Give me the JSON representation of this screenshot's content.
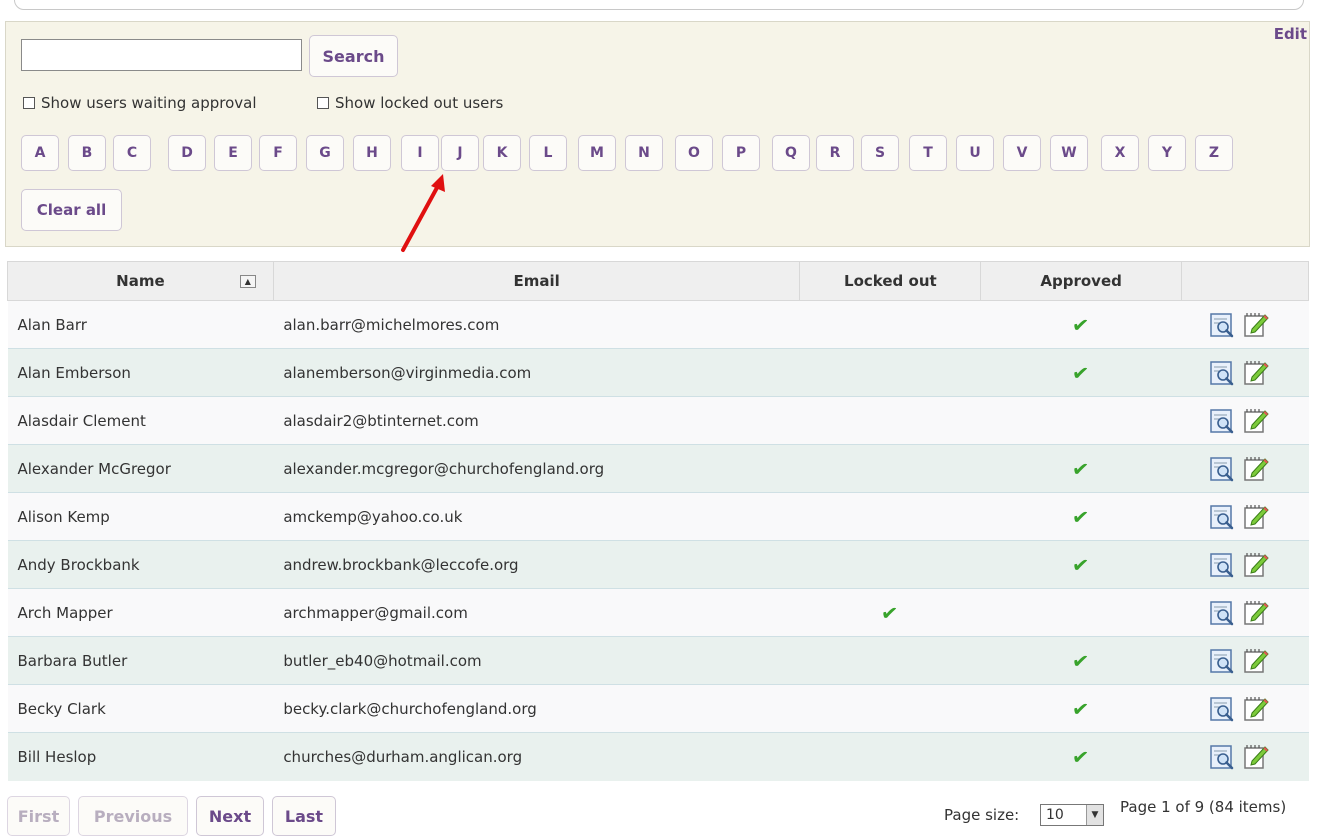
{
  "filter": {
    "edit_label": "Edit",
    "search_placeholder": "",
    "search_label": "Search",
    "show_waiting_label": "Show users waiting approval",
    "show_locked_label": "Show locked out users",
    "letters": [
      "A",
      "B",
      "C",
      "D",
      "E",
      "F",
      "G",
      "H",
      "I",
      "J",
      "K",
      "L",
      "M",
      "N",
      "O",
      "P",
      "Q",
      "R",
      "S",
      "T",
      "U",
      "V",
      "W",
      "X",
      "Y",
      "Z"
    ],
    "clear_all_label": "Clear all"
  },
  "table": {
    "headers": {
      "name": "Name",
      "email": "Email",
      "locked_out": "Locked out",
      "approved": "Approved"
    },
    "rows": [
      {
        "name": "Alan Barr",
        "email": "alan.barr@michelmores.com",
        "locked_out": false,
        "approved": true
      },
      {
        "name": "Alan Emberson",
        "email": "alanemberson@virginmedia.com",
        "locked_out": false,
        "approved": true
      },
      {
        "name": "Alasdair Clement",
        "email": "alasdair2@btinternet.com",
        "locked_out": false,
        "approved": false
      },
      {
        "name": "Alexander McGregor",
        "email": "alexander.mcgregor@churchofengland.org",
        "locked_out": false,
        "approved": true
      },
      {
        "name": "Alison Kemp",
        "email": "amckemp@yahoo.co.uk",
        "locked_out": false,
        "approved": true
      },
      {
        "name": "Andy Brockbank",
        "email": "andrew.brockbank@leccofe.org",
        "locked_out": false,
        "approved": true
      },
      {
        "name": "Arch Mapper",
        "email": "archmapper@gmail.com",
        "locked_out": true,
        "approved": false
      },
      {
        "name": "Barbara Butler",
        "email": "butler_eb40@hotmail.com",
        "locked_out": false,
        "approved": true
      },
      {
        "name": "Becky Clark",
        "email": "becky.clark@churchofengland.org",
        "locked_out": false,
        "approved": true
      },
      {
        "name": "Bill Heslop",
        "email": "churches@durham.anglican.org",
        "locked_out": false,
        "approved": true
      }
    ]
  },
  "pager": {
    "first_label": "First",
    "previous_label": "Previous",
    "next_label": "Next",
    "last_label": "Last",
    "page_size_label": "Page size:",
    "page_size_value": "10",
    "page_info": "Page 1 of 9 (84 items)"
  },
  "colors": {
    "accent": "#6b4a8a",
    "check": "#38a32b",
    "annotation": "#e01010"
  }
}
